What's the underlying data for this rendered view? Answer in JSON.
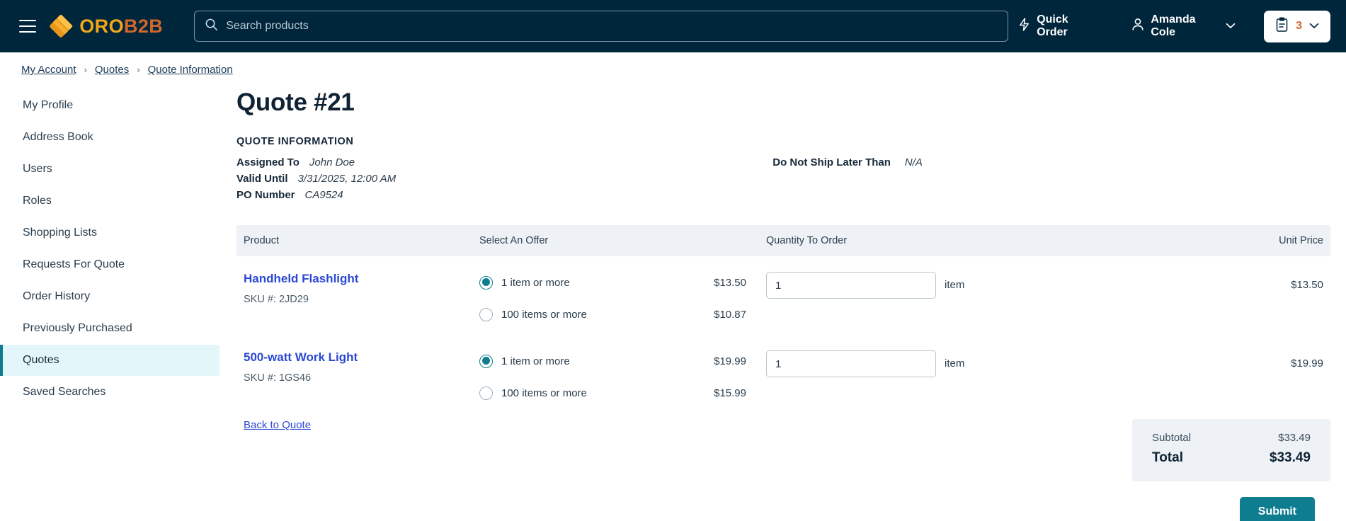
{
  "colors": {
    "header_bg": "#00263c",
    "accent_teal": "#0e7d90",
    "link_blue": "#2a48d4",
    "logo_gold": "#f2a71b",
    "logo_rust": "#d1682a",
    "table_head_bg": "#eef2f6",
    "active_nav_bg": "#e3f7fb"
  },
  "header": {
    "menu_icon": "hamburger-menu-icon",
    "logo": {
      "icon": "oro-diamond-logo-icon",
      "text_primary": "ORO",
      "text_secondary": "B2B"
    },
    "search": {
      "icon": "search-icon",
      "placeholder": "Search products",
      "value": ""
    },
    "quick_order": {
      "icon": "lightning-bolt-icon",
      "label": "Quick Order"
    },
    "user": {
      "icon": "user-icon",
      "label": "Amanda Cole",
      "chevron": "chevron-down-icon"
    },
    "cart": {
      "icon": "clipboard-list-icon",
      "count": "3",
      "chevron": "chevron-down-icon"
    }
  },
  "breadcrumb": {
    "separator": "›",
    "items": [
      {
        "label": "My Account"
      },
      {
        "label": "Quotes"
      },
      {
        "label": "Quote Information"
      }
    ]
  },
  "sidebar": {
    "items": [
      {
        "label": "My Profile",
        "active": false
      },
      {
        "label": "Address Book",
        "active": false
      },
      {
        "label": "Users",
        "active": false
      },
      {
        "label": "Roles",
        "active": false
      },
      {
        "label": "Shopping Lists",
        "active": false
      },
      {
        "label": "Requests For Quote",
        "active": false
      },
      {
        "label": "Order History",
        "active": false
      },
      {
        "label": "Previously Purchased",
        "active": false
      },
      {
        "label": "Quotes",
        "active": true
      },
      {
        "label": "Saved Searches",
        "active": false
      }
    ]
  },
  "main": {
    "page_title": "Quote #21",
    "section_label": "QUOTE INFORMATION",
    "info_left": [
      {
        "key": "Assigned To",
        "value": "John Doe"
      },
      {
        "key": "Valid Until",
        "value": "3/31/2025, 12:00 AM"
      },
      {
        "key": "PO Number",
        "value": "CA9524"
      }
    ],
    "info_right": [
      {
        "key": "Do Not Ship Later Than",
        "value": "N/A"
      }
    ],
    "table": {
      "columns": {
        "product": "Product",
        "offer": "Select An Offer",
        "quantity": "Quantity To Order",
        "unit_price": "Unit Price"
      },
      "rows": [
        {
          "name": "Handheld Flashlight",
          "sku_label": "SKU #:",
          "sku": "2JD29",
          "offers": [
            {
              "label": "1 item or more",
              "price": "$13.50",
              "selected": true
            },
            {
              "label": "100 items or more",
              "price": "$10.87",
              "selected": false
            }
          ],
          "qty_value": "1",
          "qty_unit": "item",
          "unit_price": "$13.50"
        },
        {
          "name": "500-watt Work Light",
          "sku_label": "SKU #:",
          "sku": "1GS46",
          "offers": [
            {
              "label": "1 item or more",
              "price": "$19.99",
              "selected": true
            },
            {
              "label": "100 items or more",
              "price": "$15.99",
              "selected": false
            }
          ],
          "qty_value": "1",
          "qty_unit": "item",
          "unit_price": "$19.99"
        }
      ]
    },
    "back_link": "Back to Quote",
    "totals": {
      "subtotal_label": "Subtotal",
      "subtotal_value": "$33.49",
      "total_label": "Total",
      "total_value": "$33.49"
    },
    "submit_label": "Submit"
  }
}
